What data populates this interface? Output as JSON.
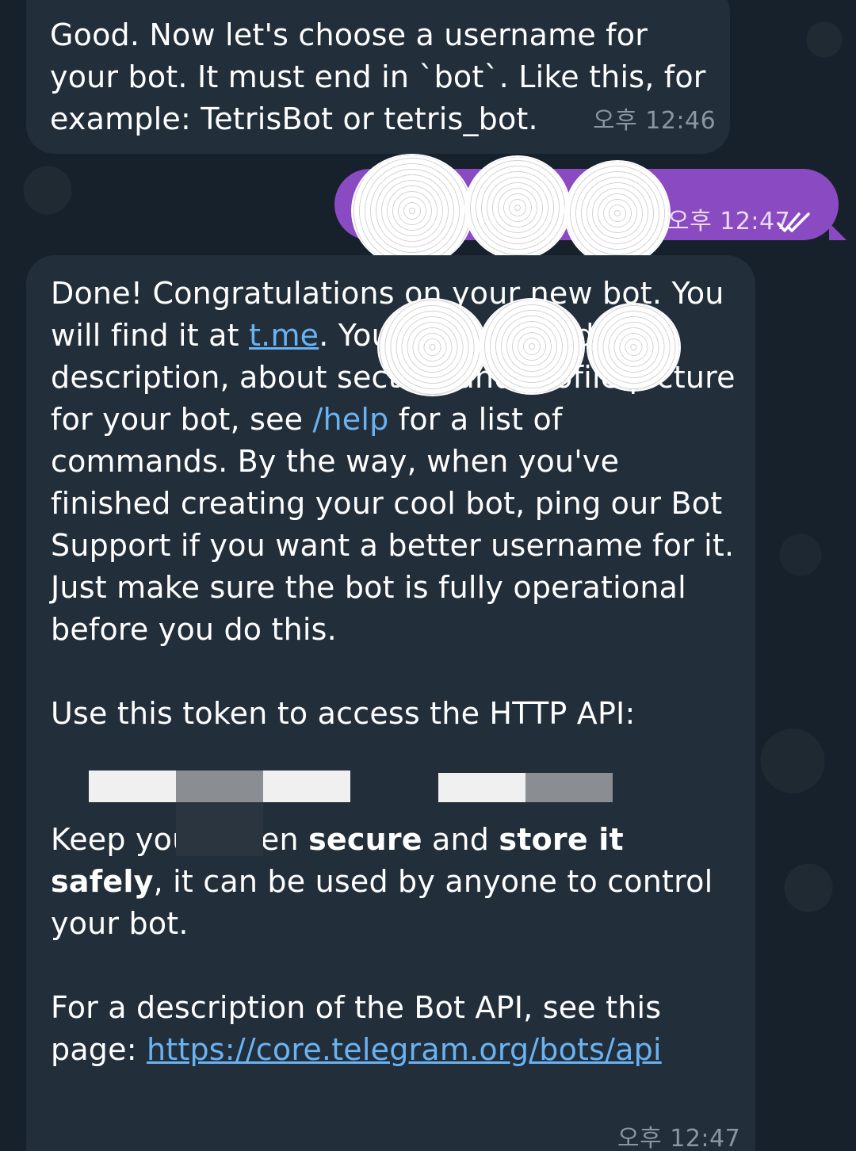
{
  "messages": {
    "username_prompt": {
      "text": "Good. Now let's choose a username for your bot. It must end in `bot`. Like this, for example: TetrisBot or tetris_bot.",
      "time": "오후 12:46"
    },
    "user_reply": {
      "text_redacted": true,
      "time": "오후 12:47",
      "status_icon": "double-check-icon"
    },
    "bot_created": {
      "line1_before": "Done! Congratulations on your new bot. You will find it at ",
      "link_text": "t.me",
      "line1_after": ". You can now add a description, about section and profile picture for your bot, see ",
      "help_command": "/help",
      "line1_rest": " for a list of commands. By the way, when you've finished creating your cool bot, ping our Bot Support if you want a better username for it. Just make sure the bot is fully operational before you do this.",
      "token_label": "Use this token to access the HTTP API:",
      "keep_before": "Keep your token ",
      "keep_bold1": "secure",
      "keep_mid": " and ",
      "keep_bold2": "store it safely",
      "keep_after": ", it can be used by anyone to control your bot.",
      "api_before": "For a description of the Bot API, see this page: ",
      "api_link": "https://core.telegram.org/bots/api",
      "time": "오후 12:47"
    }
  },
  "colors": {
    "background": "#17212b",
    "incoming_bubble": "#222e3a",
    "outgoing_bubble": "#8a4ac2",
    "link": "#6ab3f3",
    "timestamp": "#8a96a3"
  }
}
